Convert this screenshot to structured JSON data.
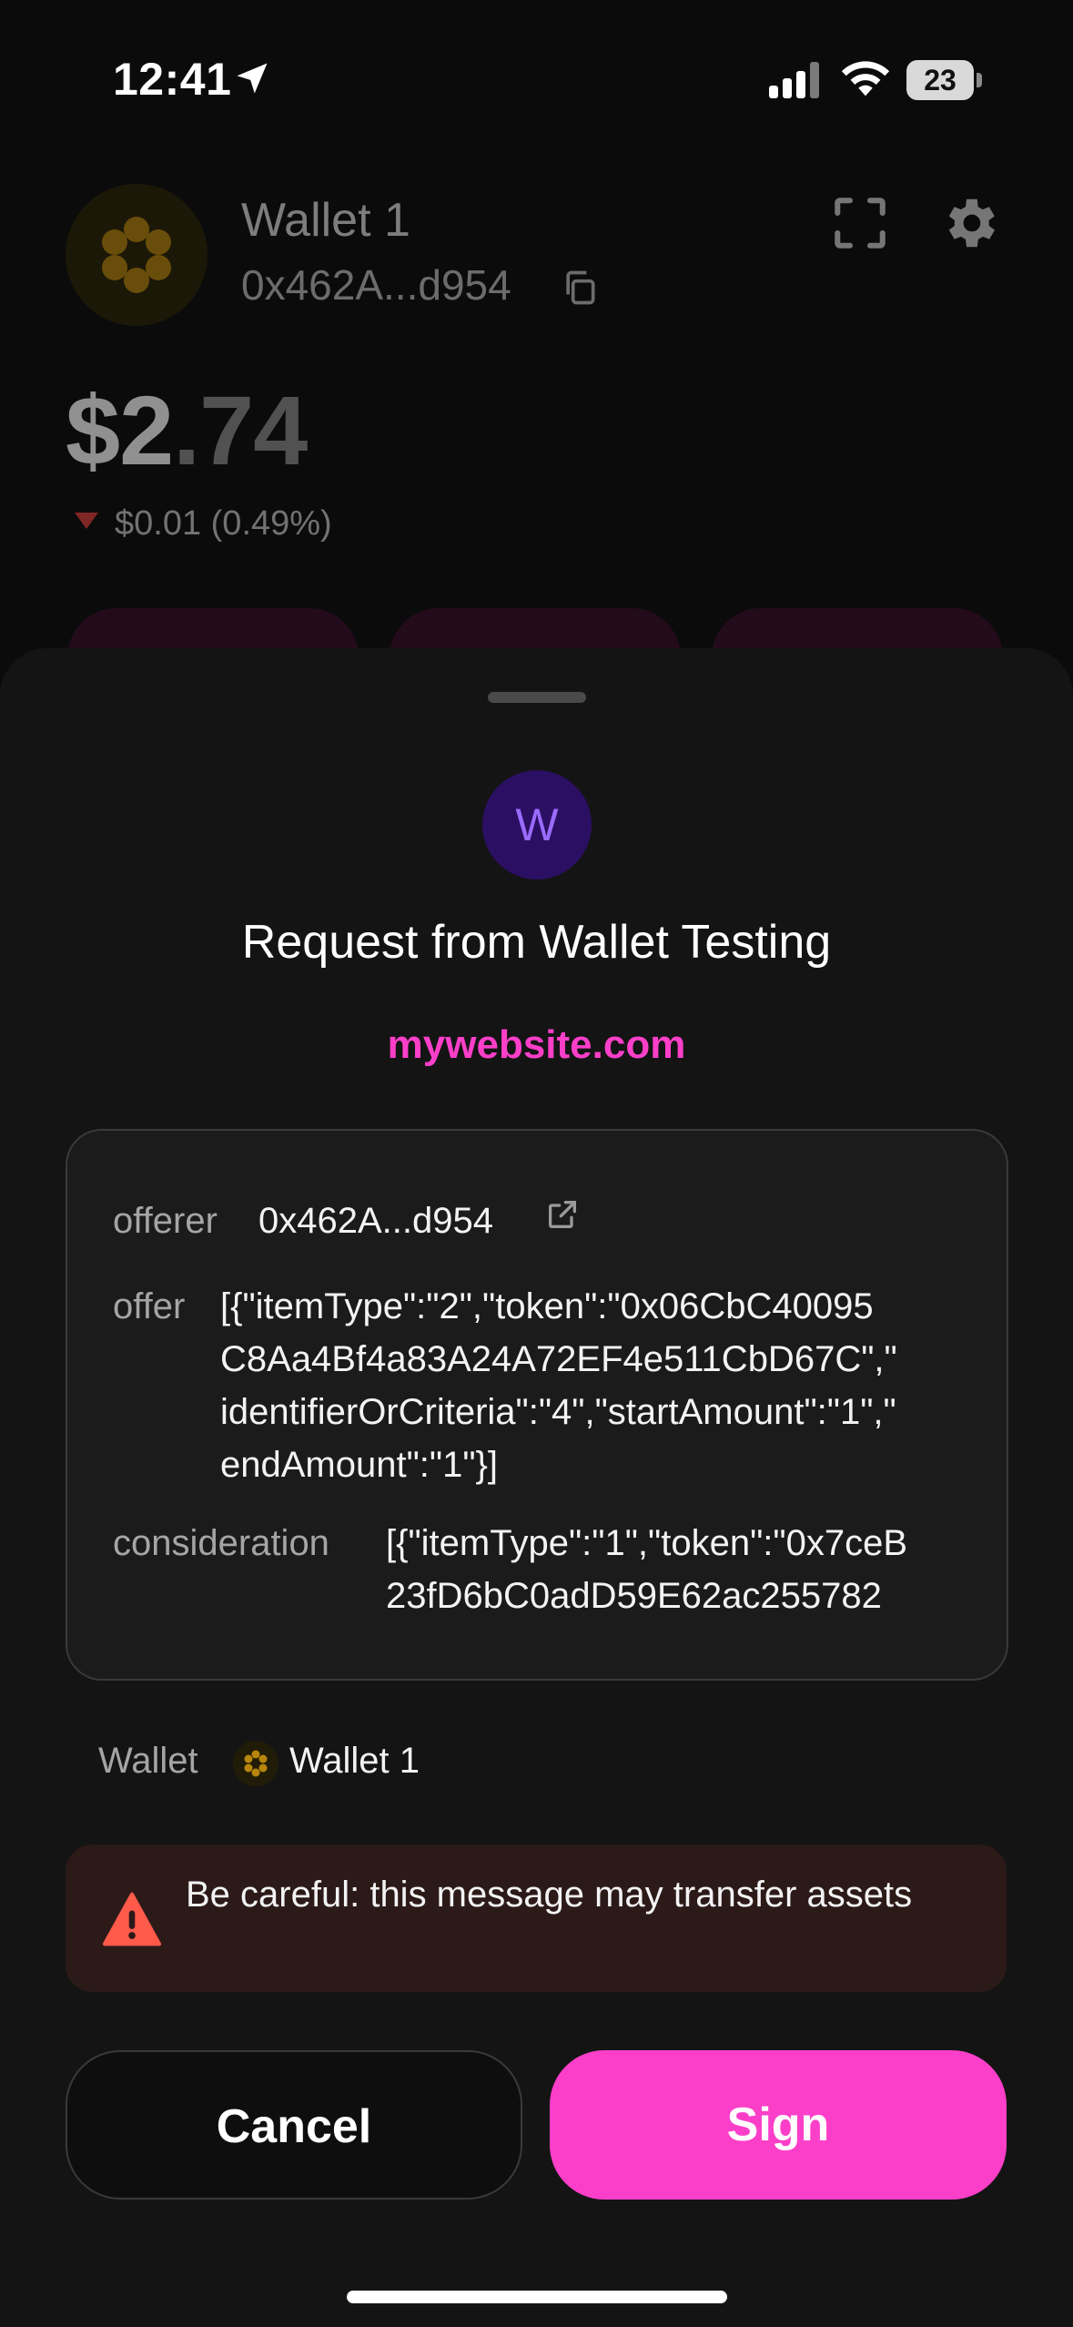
{
  "status_bar": {
    "time": "12:41",
    "battery": "23"
  },
  "wallet": {
    "name": "Wallet 1",
    "address": "0x462A...d954",
    "balance_whole": "$2",
    "balance_decimal": ".74",
    "change": "$0.01 (0.49%)",
    "change_direction": "down"
  },
  "request": {
    "app_initial": "W",
    "title": "Request from Wallet Testing",
    "url": "mywebsite.com"
  },
  "message": {
    "fields": [
      {
        "label": "offerer",
        "value": "0x462A...d954"
      },
      {
        "label": "offer",
        "value": "[{\"itemType\":\"2\",\"token\":\"0x06CbC40095\nC8Aa4Bf4a83A24A72EF4e511CbD67C\",\"\nidentifierOrCriteria\":\"4\",\"startAmount\":\"1\",\"\nendAmount\":\"1\"}]"
      },
      {
        "label": "consideration",
        "value": "[{\"itemType\":\"1\",\"token\":\"0x7ceB\n23fD6bC0adD59E62ac255782"
      }
    ]
  },
  "wallet_row": {
    "label": "Wallet",
    "name": "Wallet 1"
  },
  "warning": {
    "text": "Be careful: this message may transfer assets"
  },
  "buttons": {
    "cancel": "Cancel",
    "sign": "Sign"
  },
  "colors": {
    "accent": "#fc3fc9",
    "warning_bg": "#2c1a19",
    "warning_icon": "#ff5a4a"
  }
}
